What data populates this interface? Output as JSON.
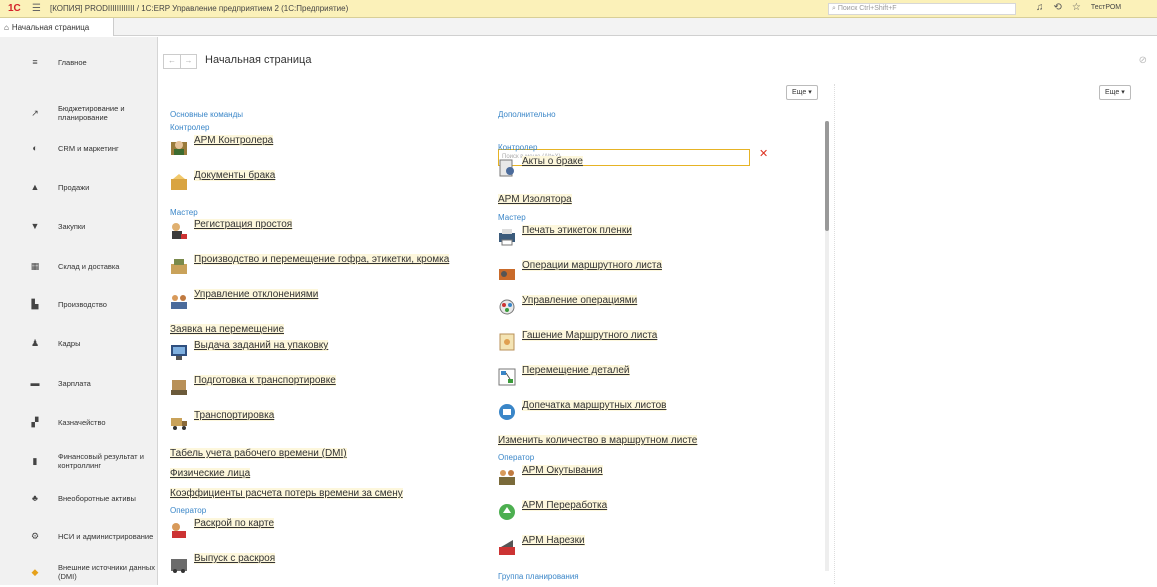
{
  "titlebar": {
    "logo": "1С",
    "title": "[КОПИЯ] PRODIIIIIIIIIIII / 1С:ERP Управление предприятием 2  (1С:Предприятие)",
    "search_placeholder": "Поиск Ctrl+Shift+F",
    "user": "ТестРОМ"
  },
  "tabs": {
    "home": "Начальная страница"
  },
  "sidebar": {
    "items": [
      {
        "label": "Главное",
        "icon": "≡"
      },
      {
        "label": "Бюджетирование и планирование",
        "icon": "↗"
      },
      {
        "label": "CRM и маркетинг",
        "icon": "◐"
      },
      {
        "label": "Продажи",
        "icon": "▲"
      },
      {
        "label": "Закупки",
        "icon": "▼"
      },
      {
        "label": "Склад и доставка",
        "icon": "▦"
      },
      {
        "label": "Производство",
        "icon": "▙"
      },
      {
        "label": "Кадры",
        "icon": "♟"
      },
      {
        "label": "Зарплата",
        "icon": "▬"
      },
      {
        "label": "Казначейство",
        "icon": "▞"
      },
      {
        "label": "Финансовый результат и контроллинг",
        "icon": "▮"
      },
      {
        "label": "Внеоборотные активы",
        "icon": "♣"
      },
      {
        "label": "НСИ и администрирование",
        "icon": "⚙"
      },
      {
        "label": "Внешние источники данных (DMI)",
        "icon": "◆"
      }
    ]
  },
  "main": {
    "title": "Начальная страница",
    "more_label": "Еще ▾",
    "left": {
      "header": "Основные команды",
      "g1": "Контролер",
      "arm_controller": "АРМ Контролера",
      "defect_docs": "Документы брака",
      "g2": "Мастер",
      "downtime_reg": "Регистрация простоя",
      "prod_move": "Производство и перемещение гофра, этикетки, кромка",
      "deviation_mgmt": "Управление отклонениями",
      "move_request": "Заявка на перемещение",
      "pack_tasks": "Выдача заданий на упаковку",
      "transport_prep": "Подготовка к транспортировке",
      "transport": "Транспортировка",
      "timesheet": "Табель учета рабочего времени (DMI)",
      "persons": "Физические лица",
      "loss_coef": "Коэффициенты расчета потерь времени за смену",
      "g3": "Оператор",
      "cut_card": "Раскрой по карте",
      "cut_output": "Выпуск с раскроя"
    },
    "right": {
      "header": "Дополнительно",
      "search_placeholder": "Поиск в меню (Alt+X)",
      "g1": "Контролер",
      "defect_acts": "Акты о браке",
      "arm_isolator": "АРМ Изолятора",
      "g2": "Мастер",
      "film_labels": "Печать этикеток пленки",
      "route_ops": "Операции маршрутного листа",
      "ops_mgmt": "Управление операциями",
      "route_cancel": "Гашение Маршрутного листа",
      "parts_move": "Перемещение деталей",
      "route_reprint": "Допечатка маршрутных листов",
      "route_qty": "Изменить количество в маршрутном листе",
      "g3": "Оператор",
      "arm_wrap": "АРМ Окутывания",
      "arm_recycle": "АРМ Переработка",
      "arm_cut": "АРМ Нарезки",
      "g4": "Группа планирования"
    }
  }
}
